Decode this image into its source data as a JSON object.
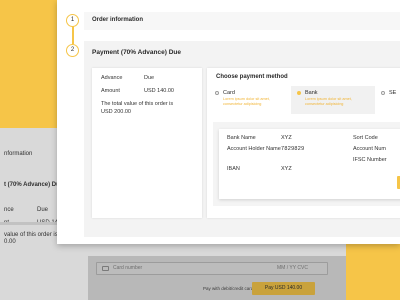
{
  "background": {
    "section_title": "nformation",
    "payment_title": "t (70% Advance)  Due",
    "rows": [
      {
        "key": "nce",
        "value": "Due"
      },
      {
        "key": "nt",
        "value": "USD 140.00"
      }
    ],
    "note_line1": "value of this order is",
    "note_line2": "0.00",
    "card_number_placeholder": "Card number",
    "expiry_placeholder": "MM / YY  CVC",
    "pay_label": "Pay with debit/credit card",
    "pay_button": "Pay USD 140.00"
  },
  "steps": [
    {
      "number": "1",
      "title": "Order information"
    },
    {
      "number": "2",
      "title": "Payment (70% Advance)  Due"
    }
  ],
  "summary": {
    "rows": [
      {
        "key": "Advance",
        "value": "Due"
      },
      {
        "key": "Amount",
        "value": "USD 140.00"
      }
    ],
    "note_line1": "The total value of this order is",
    "note_line2": "USD 200.00"
  },
  "payment": {
    "title": "Choose payment method",
    "options": [
      {
        "label": "Card",
        "desc": "Lorem ipsum dolor sit amet, consectetur adipisicing",
        "selected": false
      },
      {
        "label": "Bank",
        "desc": "Lorem ipsum dolor sit amet, consectetur adipisicing",
        "selected": true
      },
      {
        "label": "SE",
        "desc": "",
        "selected": false
      }
    ],
    "bank_details": {
      "left": [
        {
          "key": "Bank Name",
          "value": "XYZ"
        },
        {
          "key": "Account Holder Name",
          "value": "7829829"
        },
        {
          "key": "IBAN",
          "value": "XYZ"
        }
      ],
      "right": [
        {
          "key": "Sort Code"
        },
        {
          "key": "Account Num"
        },
        {
          "key": "IFSC Number"
        }
      ]
    }
  },
  "colors": {
    "accent": "#f6c548",
    "background": "#f6c548",
    "muted_overlay": "#d9d9d9"
  }
}
